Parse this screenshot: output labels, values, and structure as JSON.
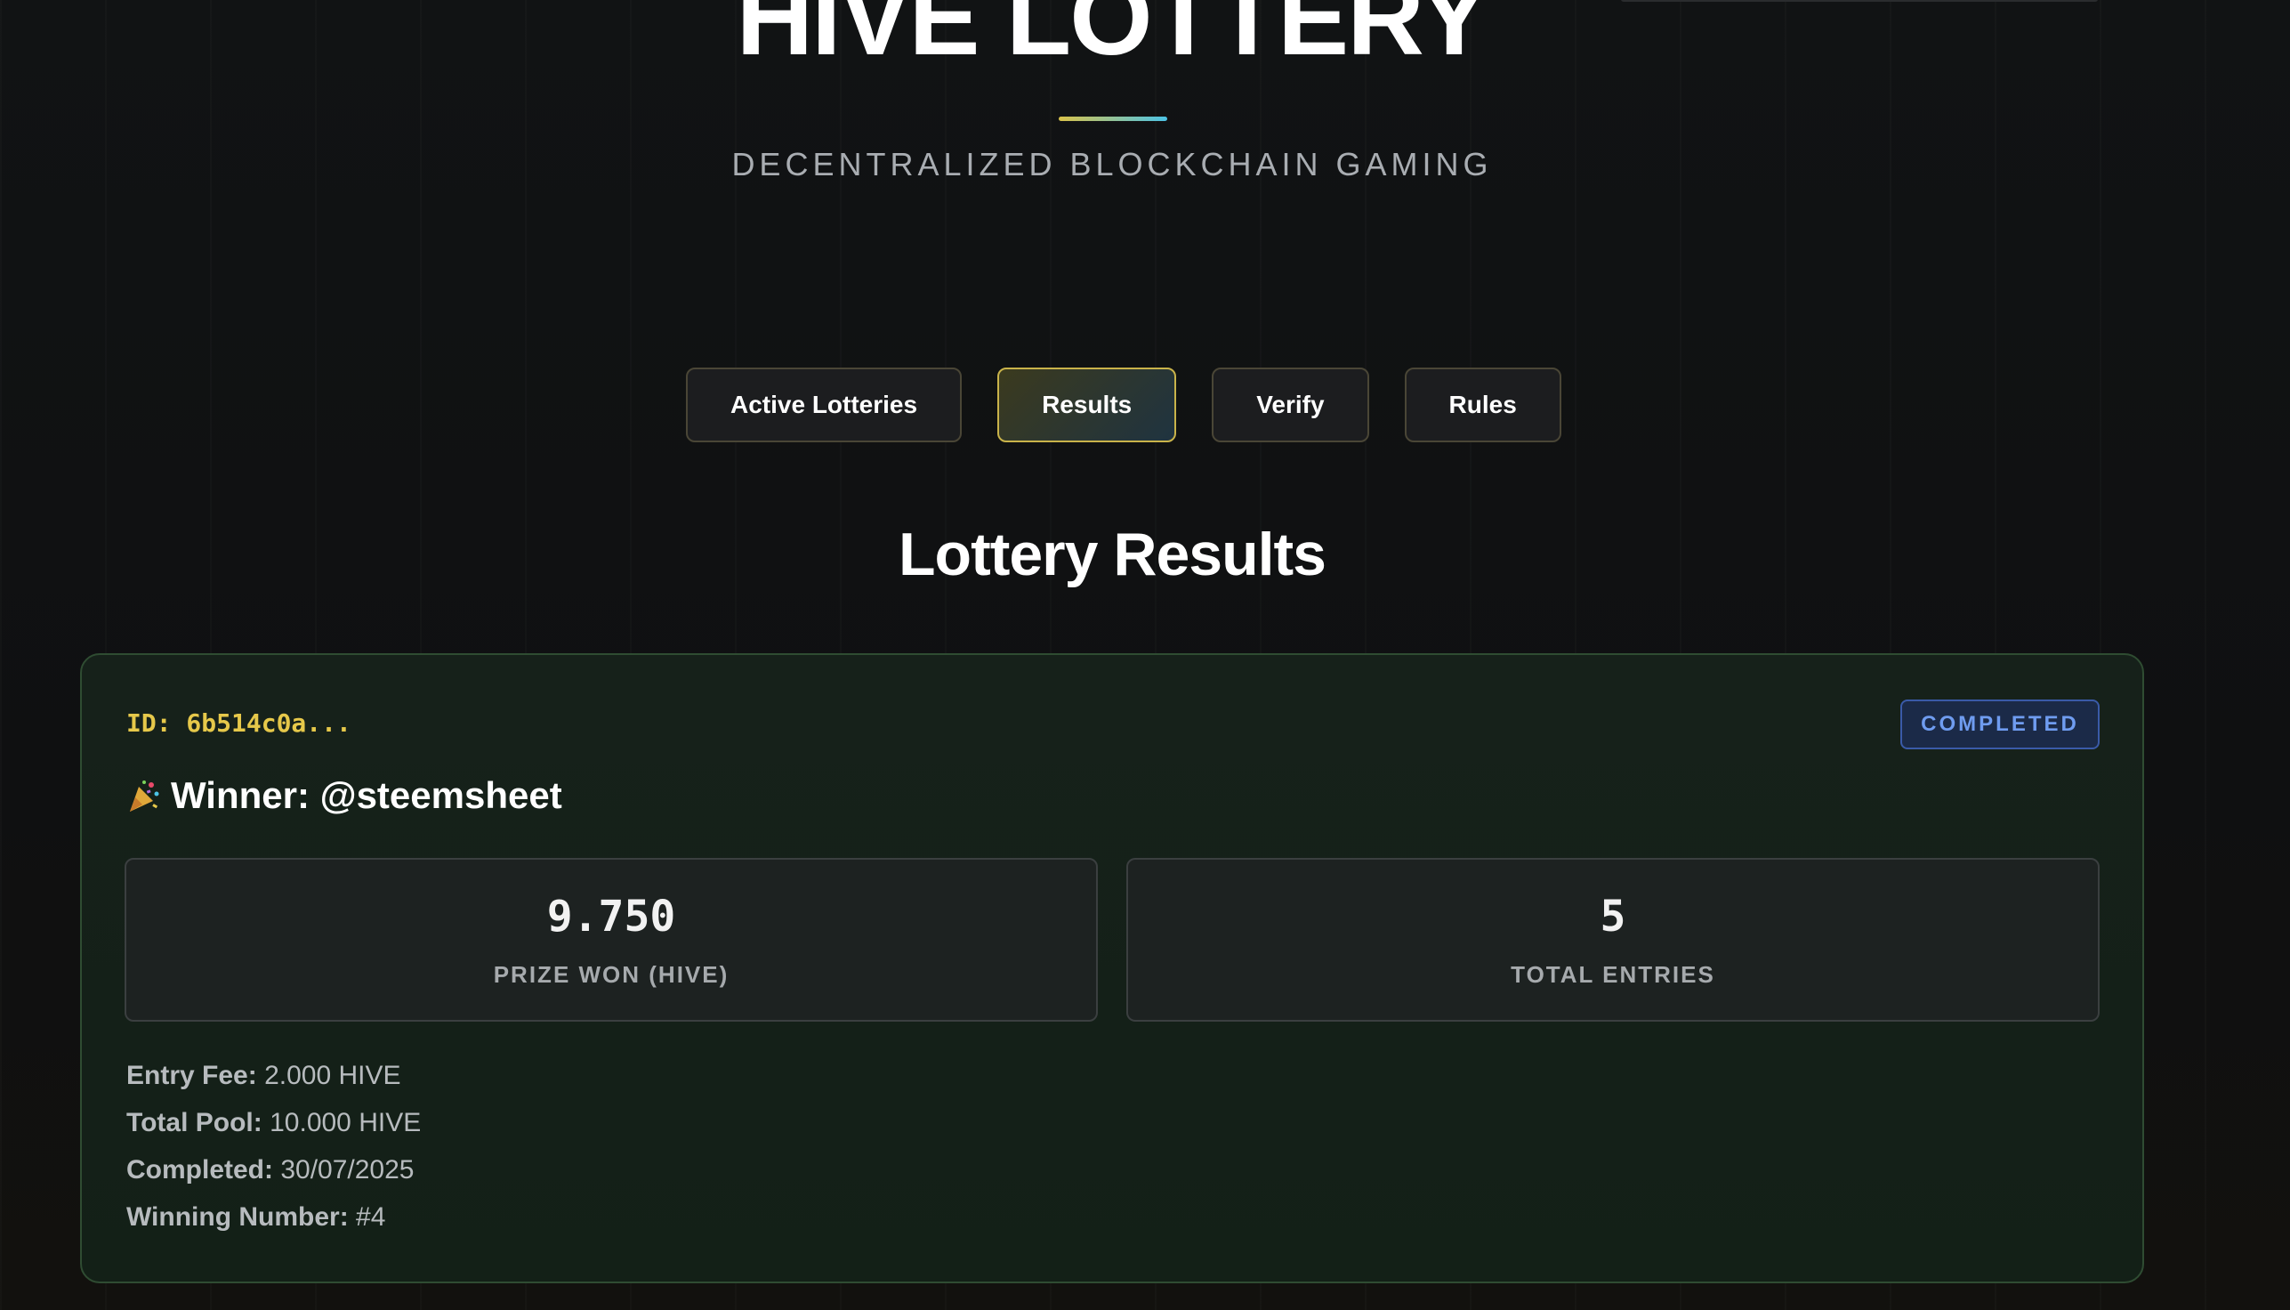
{
  "brand": {
    "title": "HIVE LOTTERY",
    "tagline": "DECENTRALIZED BLOCKCHAIN GAMING"
  },
  "nav": {
    "tabs": [
      {
        "label": "Active Lotteries",
        "active": false
      },
      {
        "label": "Results",
        "active": true
      },
      {
        "label": "Verify",
        "active": false
      },
      {
        "label": "Rules",
        "active": false
      }
    ]
  },
  "section": {
    "title": "Lottery Results"
  },
  "result": {
    "id": "ID: 6b514c0a...",
    "status": "COMPLETED",
    "winner_label": "Winner: @steemsheet",
    "prize": {
      "value": "9.750",
      "label": "PRIZE WON (HIVE)"
    },
    "entries": {
      "value": "5",
      "label": "TOTAL ENTRIES"
    },
    "details": [
      {
        "label": "Entry Fee:",
        "value": "2.000 HIVE"
      },
      {
        "label": "Total Pool:",
        "value": "10.000 HIVE"
      },
      {
        "label": "Completed:",
        "value": "30/07/2025"
      },
      {
        "label": "Winning Number:",
        "value": "#4"
      }
    ]
  },
  "icons": {
    "winner": "party-popper-icon"
  },
  "colors": {
    "accent_gold": "#e6c84a",
    "accent_cyan": "#4cc3e6",
    "status_blue": "#6f9cf0",
    "card_border": "#2f4c32"
  }
}
